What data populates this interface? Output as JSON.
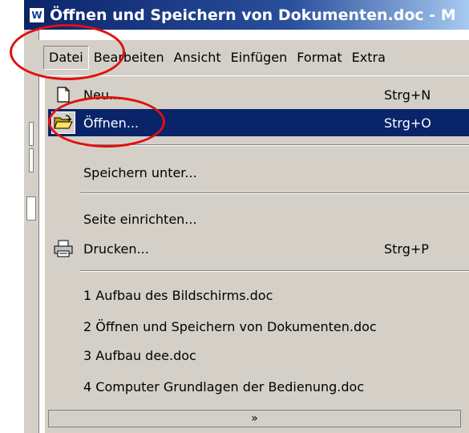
{
  "window": {
    "title": "Öffnen und Speichern von Dokumenten.doc - M",
    "app_icon": "word-doc-icon"
  },
  "menubar": {
    "items": [
      {
        "label": "Datei",
        "active": true
      },
      {
        "label": "Bearbeiten"
      },
      {
        "label": "Ansicht"
      },
      {
        "label": "Einfügen"
      },
      {
        "label": "Format"
      },
      {
        "label": "Extra"
      }
    ]
  },
  "file_menu": {
    "items": [
      {
        "label": "Neu...",
        "shortcut": "Strg+N",
        "icon": "new-document-icon"
      },
      {
        "label": "Öffnen...",
        "shortcut": "Strg+O",
        "icon": "open-folder-icon",
        "highlighted": true
      },
      {
        "label": "Speichern unter...",
        "shortcut": ""
      },
      {
        "label": "Seite einrichten...",
        "shortcut": ""
      },
      {
        "label": "Drucken...",
        "shortcut": "Strg+P",
        "icon": "printer-icon"
      },
      {
        "label": "1 Aufbau des Bildschirms.doc"
      },
      {
        "label": "2 Öffnen und Speichern von Dokumenten.doc"
      },
      {
        "label": "3 Aufbau dee.doc"
      },
      {
        "label": "4 Computer Grundlagen der Bedienung.doc"
      }
    ],
    "expand_icon": "double-chevron-down-icon"
  },
  "colors": {
    "menu_bg": "#d4d0c8",
    "highlight": "#0a246a",
    "annotation": "#e01010"
  }
}
